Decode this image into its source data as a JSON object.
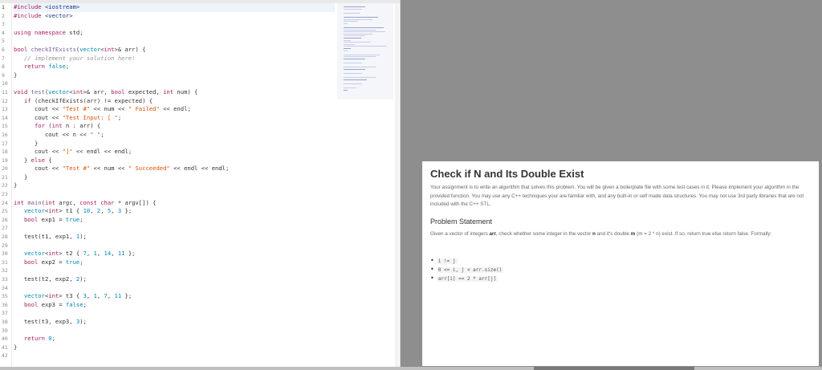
{
  "editor": {
    "line_numbers": [
      "1",
      "2",
      "3",
      "4",
      "5",
      "6",
      "7",
      "8",
      "9",
      "10",
      "11",
      "12",
      "13",
      "14",
      "15",
      "16",
      "17",
      "18",
      "19",
      "20",
      "21",
      "22",
      "23",
      "24",
      "25",
      "26",
      "27",
      "28",
      "29",
      "30",
      "31",
      "32",
      "33",
      "34",
      "35",
      "36",
      "37",
      "38",
      "39",
      "40",
      "41",
      "42"
    ],
    "active_line": 1
  },
  "problem": {
    "title": "Check if N and Its Double Exist",
    "description": "Your assignment is to write an algorithm that solves this problem. You will be given a boilerplate file with some test cases in it. Please implement your algorithm in the provided function. You may use any C++ techniques your are familiar with, and any built-in or self made data structures. You may not use 3rd party libraries that are not included with the C++ STL.",
    "statement_heading": "Problem Statement",
    "statement_before_arr": "Given a vector of integers ",
    "statement_arr": "arr",
    "statement_middle": ", check whether some integer in the vector ",
    "statement_n": "n",
    "statement_after_n": " and it's double ",
    "statement_m": "m",
    "statement_formula": " (m = 2 * n)",
    "statement_end": " exist. If so, return true else return false. Formally:",
    "rules": [
      "i != j",
      "0 <= i, j < arr.size()",
      "arr[i] == 2 * arr[j]"
    ]
  },
  "colors": {
    "background": "#8e8e8e",
    "keyword": "#a71d5d",
    "type": "#0086b3",
    "string": "#df5000",
    "comment": "#969896"
  }
}
